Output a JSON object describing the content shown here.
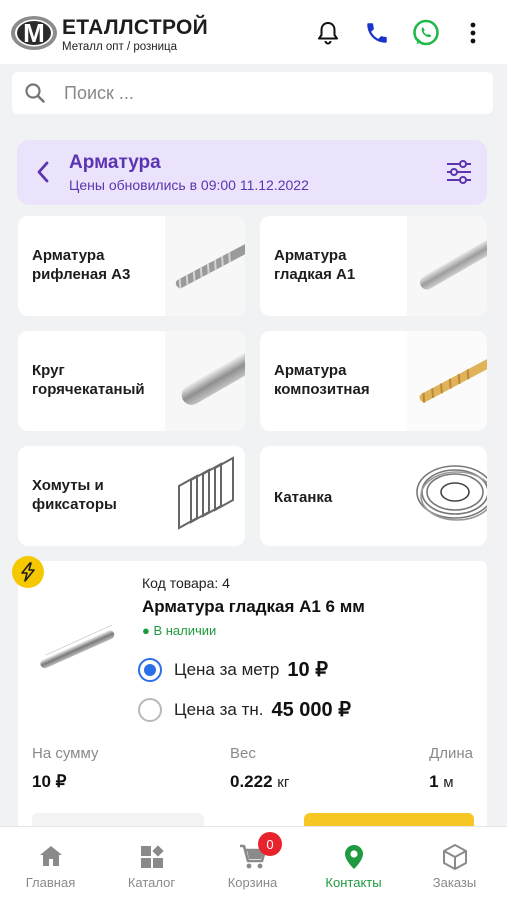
{
  "header": {
    "logo_letter": "M",
    "logo_title": "ЕТАЛЛСТРОЙ",
    "logo_subtitle": "Металл опт / розница",
    "icons": [
      "bell-icon",
      "phone-icon",
      "whatsapp-icon",
      "more-vert-icon"
    ],
    "colors": {
      "phone": "#1a33c8",
      "whatsapp": "#22b84a"
    }
  },
  "search": {
    "placeholder": "Поиск ..."
  },
  "category": {
    "title": "Арматура",
    "update_text": "Цены обновились в  09:00 11.12.2022",
    "accent": "#5b35b1"
  },
  "tiles": [
    {
      "label": "Арматура рифленая А3"
    },
    {
      "label": "Арматура гладкая А1"
    },
    {
      "label": "Круг горячекатаный"
    },
    {
      "label": "Арматура композитная"
    },
    {
      "label": "Хомуты и фиксаторы"
    },
    {
      "label": "Катанка"
    }
  ],
  "product": {
    "code": "Код товара: 4",
    "name": "Арматура гладкая А1  6 мм",
    "stock": "● В наличии",
    "price_options": [
      {
        "label": "Цена за метр",
        "price": "10 ₽",
        "selected": true
      },
      {
        "label": "Цена за тн.",
        "price": "45 000 ₽",
        "selected": false
      }
    ],
    "stats": [
      {
        "label": "На сумму",
        "value": "10 ₽",
        "unit": ""
      },
      {
        "label": "Вес",
        "value": "0.222",
        "unit": "кг"
      },
      {
        "label": "Длина",
        "value": "1",
        "unit": "м"
      }
    ]
  },
  "tabbar": {
    "tabs": [
      {
        "label": "Главная",
        "icon": "home-icon"
      },
      {
        "label": "Каталог",
        "icon": "catalog-icon"
      },
      {
        "label": "Корзина",
        "icon": "cart-icon"
      },
      {
        "label": "Контакты",
        "icon": "location-icon",
        "active": true
      },
      {
        "label": "Заказы",
        "icon": "box-icon"
      }
    ],
    "cart_count": "0",
    "active_color": "#1f9a41"
  }
}
